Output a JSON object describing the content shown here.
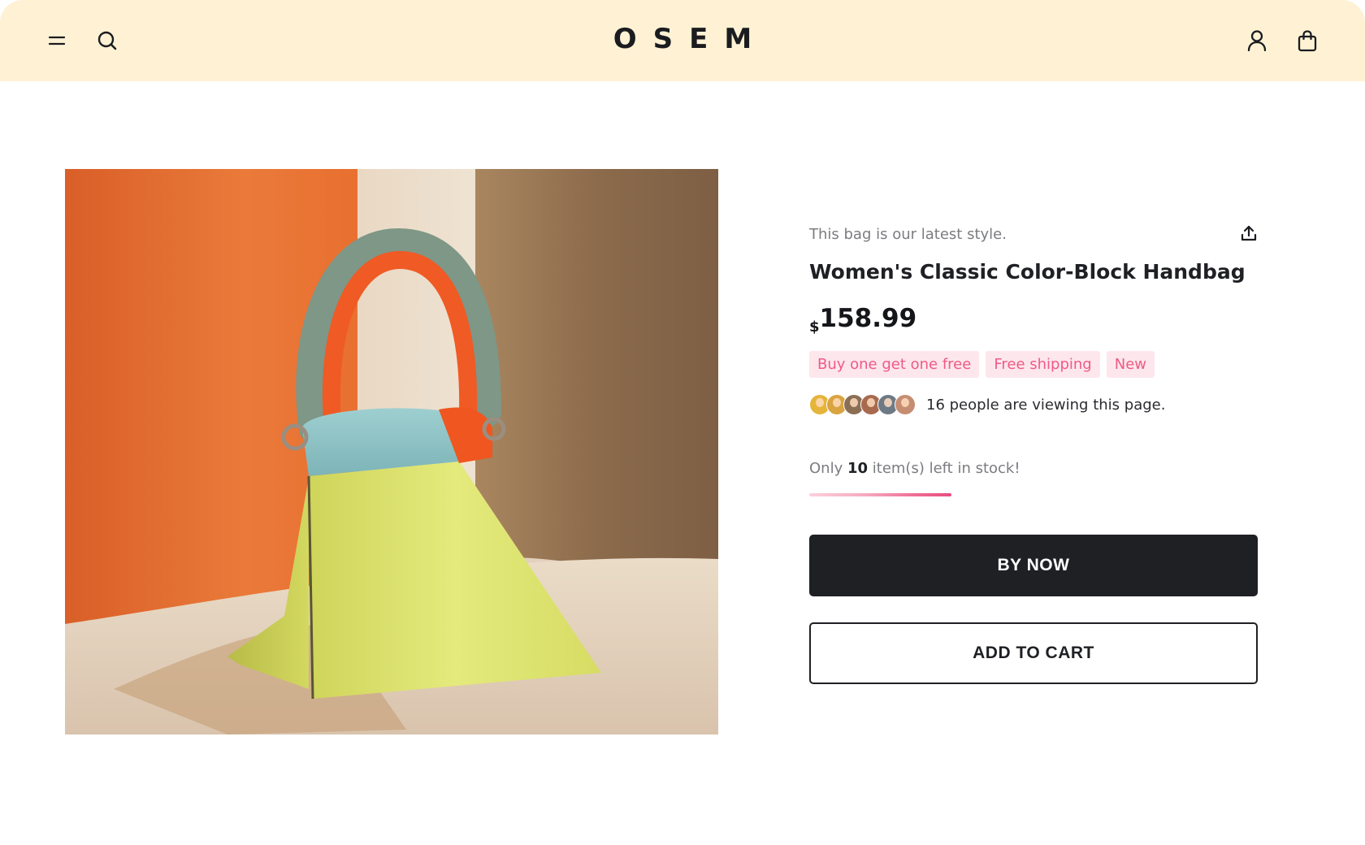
{
  "header": {
    "logo": "OSEM",
    "icons": [
      "menu-icon",
      "search-icon",
      "user-icon",
      "shopping-bag-icon"
    ],
    "background": "#fff2d4"
  },
  "product": {
    "tagline": "This bag is our latest style.",
    "title": "Women's Classic Color-Block Handbag",
    "currency": "$",
    "price": "158.99",
    "badges": [
      "Buy one get one free",
      "Free shipping",
      "New"
    ],
    "viewers": {
      "count_text": "16 people are viewing this page.",
      "avatar_colors": [
        "#e5b53a",
        "#d9a441",
        "#8b6f55",
        "#a86a4e",
        "#6d7a86",
        "#c58d72"
      ]
    },
    "stock": {
      "prefix": "Only",
      "count": "10",
      "suffix": "item(s) left in stock!",
      "level": 0.1
    },
    "buttons": {
      "buy_now": "BY NOW",
      "add_to_cart": "ADD TO CART"
    }
  },
  "colors": {
    "badge_text": "#ef5b86",
    "badge_bg": "#fde7ec",
    "primary_button": "#1f2024"
  }
}
